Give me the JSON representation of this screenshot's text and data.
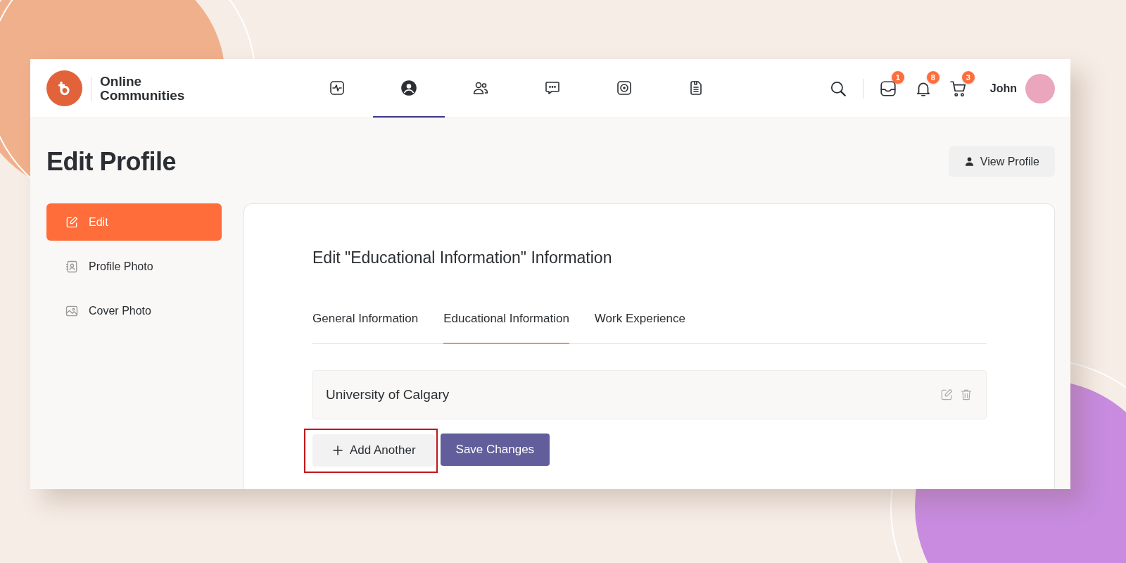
{
  "header": {
    "brand": {
      "line_1": "Online",
      "line_2": "Communities"
    },
    "nav": [
      {
        "selected": false
      },
      {
        "selected": true
      },
      {
        "selected": false
      },
      {
        "selected": false
      },
      {
        "selected": false
      },
      {
        "selected": false
      }
    ],
    "actions": [
      {
        "badge": "1"
      },
      {
        "badge": "8"
      },
      {
        "badge": "3"
      }
    ],
    "user": {
      "name": "John"
    }
  },
  "page_title": "Edit Profile",
  "view_profile_button": "View Profile",
  "sidebar": {
    "items": [
      {
        "label": "Edit",
        "selected": true
      },
      {
        "label": "Profile Photo",
        "selected": false
      },
      {
        "label": "Cover Photo",
        "selected": false
      }
    ]
  },
  "card": {
    "title": "Edit \"Educational Information\" Information",
    "tabs": [
      {
        "label": "General Information",
        "selected": false
      },
      {
        "label": "Educational Information",
        "selected": true
      },
      {
        "label": "Work Experience",
        "selected": false
      }
    ],
    "entries": [
      {
        "name": "University of Calgary"
      }
    ],
    "buttons": [
      {
        "kind": "secondary",
        "label": "Add Another",
        "highlighted": true
      },
      {
        "kind": "primary",
        "label": "Save Changes",
        "highlighted": false
      }
    ]
  }
}
